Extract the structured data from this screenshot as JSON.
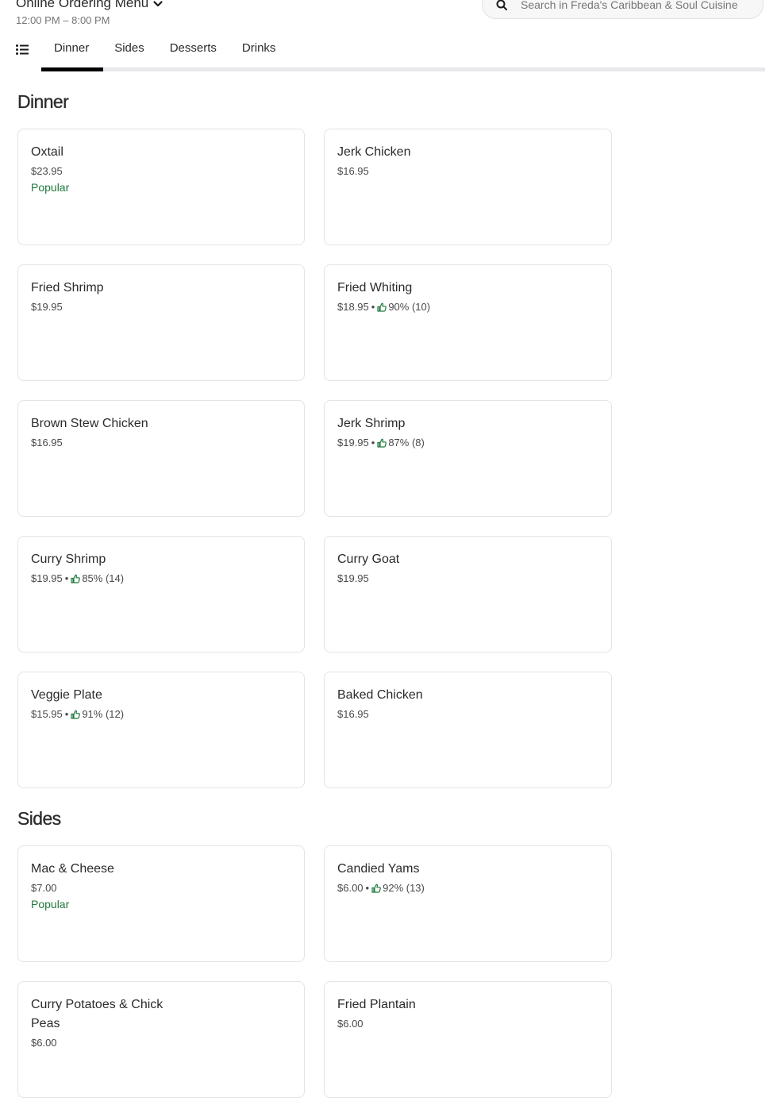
{
  "header": {
    "menu_title": "Online Ordering Menu",
    "hours": "12:00 PM – 8:00 PM",
    "search_placeholder": "Search in Freda's Caribbean & Soul Cuisine"
  },
  "tabs": [
    {
      "label": "Dinner",
      "active": true
    },
    {
      "label": "Sides",
      "active": false
    },
    {
      "label": "Desserts",
      "active": false
    },
    {
      "label": "Drinks",
      "active": false
    }
  ],
  "colors": {
    "accent": "#000000",
    "popular": "#1f7a3d",
    "tab_track": "#e8e8ec"
  },
  "sections": [
    {
      "title": "Dinner",
      "items": [
        {
          "name": "Oxtail",
          "price": "$23.95",
          "popular": "Popular"
        },
        {
          "name": "Jerk Chicken",
          "price": "$16.95"
        },
        {
          "name": "Fried Shrimp",
          "price": "$19.95"
        },
        {
          "name": "Fried Whiting",
          "price": "$18.95",
          "rating": "90% (10)"
        },
        {
          "name": "Brown Stew Chicken",
          "price": "$16.95"
        },
        {
          "name": "Jerk Shrimp",
          "price": "$19.95",
          "rating": "87% (8)"
        },
        {
          "name": "Curry Shrimp",
          "price": "$19.95",
          "rating": "85% (14)"
        },
        {
          "name": "Curry Goat",
          "price": "$19.95"
        },
        {
          "name": "Veggie Plate",
          "price": "$15.95",
          "rating": "91% (12)"
        },
        {
          "name": "Baked Chicken",
          "price": "$16.95"
        }
      ]
    },
    {
      "title": "Sides",
      "items": [
        {
          "name": "Mac & Cheese",
          "price": "$7.00",
          "popular": "Popular"
        },
        {
          "name": "Candied Yams",
          "price": "$6.00",
          "rating": "92% (13)"
        },
        {
          "name": "Curry Potatoes & Chick Peas",
          "price": "$6.00"
        },
        {
          "name": "Fried Plantain",
          "price": "$6.00"
        }
      ]
    }
  ]
}
